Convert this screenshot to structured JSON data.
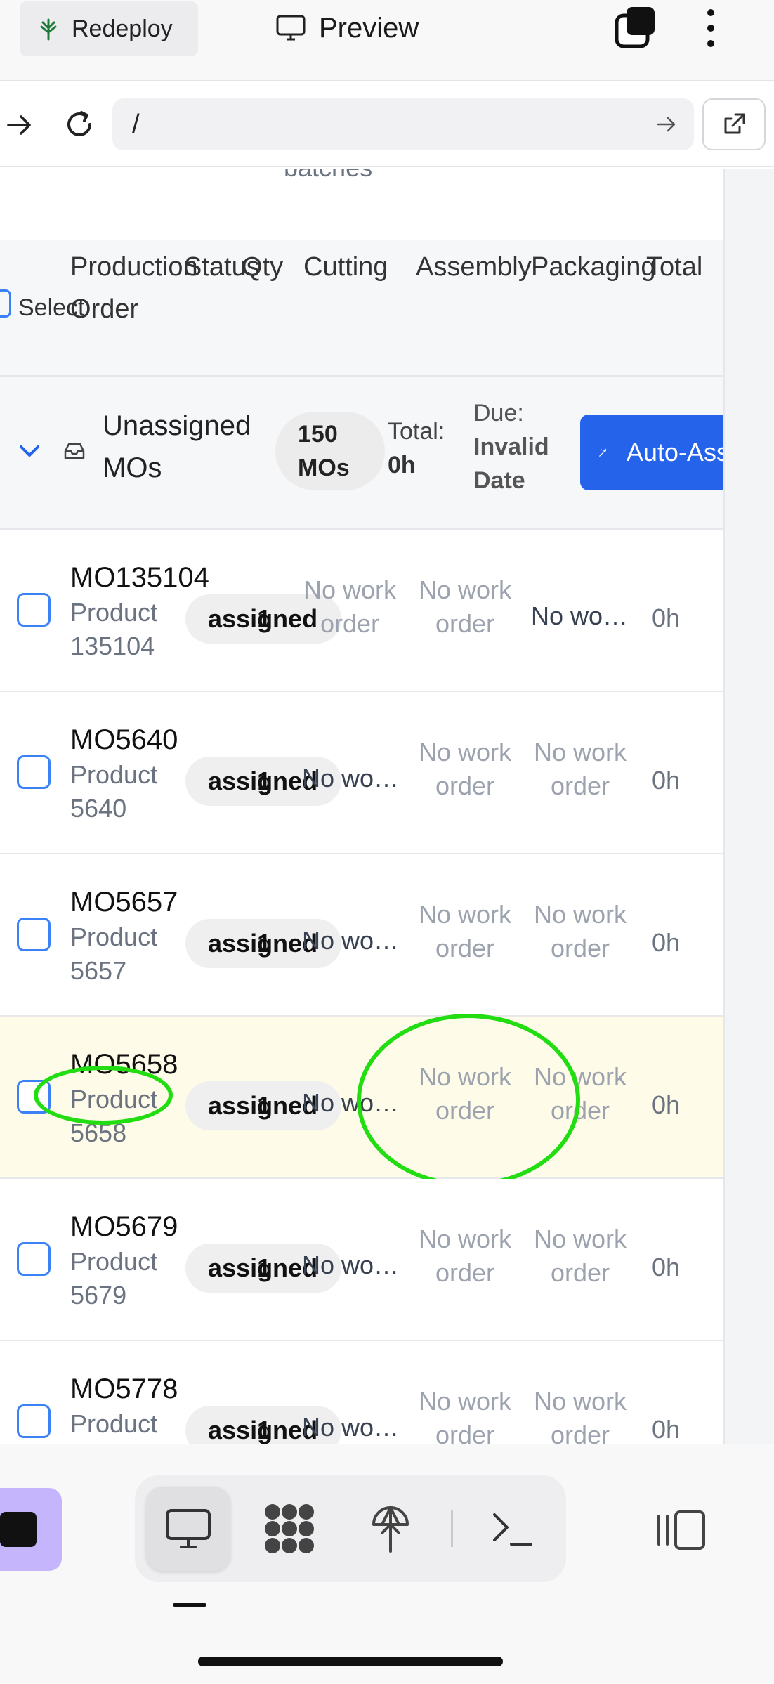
{
  "toolbar": {
    "redeploy_label": "Redeploy",
    "preview_label": "Preview"
  },
  "address": {
    "url": "/"
  },
  "content": {
    "partial_header_text": "batches"
  },
  "table": {
    "columns": {
      "select": "Select",
      "production_order": "Production Order",
      "status": "Status",
      "qty": "Qty",
      "cutting": "Cutting",
      "assembly": "Assembly",
      "packaging": "Packaging",
      "total": "Total"
    }
  },
  "group": {
    "title": "Unassigned MOs",
    "count_label": "150 MOs",
    "total_label": "Total:",
    "total_value": "0h",
    "due_label": "Due:",
    "due_value": "Invalid Date",
    "auto_assign_label": "Auto-Assign"
  },
  "rows": [
    {
      "mo": "MO135104",
      "product": "Product 135104",
      "status": "assigned",
      "qty": "1",
      "cutting": "No work order",
      "assembly": "No work order",
      "packaging": "No wo…",
      "total": "0h"
    },
    {
      "mo": "MO5640",
      "product": "Product 5640",
      "status": "assigned",
      "qty": "1",
      "cutting": "No wo…",
      "assembly": "No work order",
      "packaging": "No work order",
      "total": "0h"
    },
    {
      "mo": "MO5657",
      "product": "Product 5657",
      "status": "assigned",
      "qty": "1",
      "cutting": "No wo…",
      "assembly": "No work order",
      "packaging": "No work order",
      "total": "0h"
    },
    {
      "mo": "MO5658",
      "product": "Product 5658",
      "status": "assigned",
      "qty": "1",
      "cutting": "No wo…",
      "assembly": "No work order",
      "packaging": "No work order",
      "total": "0h"
    },
    {
      "mo": "MO5679",
      "product": "Product 5679",
      "status": "assigned",
      "qty": "1",
      "cutting": "No wo…",
      "assembly": "No work order",
      "packaging": "No work order",
      "total": "0h"
    },
    {
      "mo": "MO5778",
      "product": "Product",
      "status": "assigned",
      "qty": "1",
      "cutting": "No wo…",
      "assembly": "No work order",
      "packaging": "No work order",
      "total": "0h"
    }
  ],
  "colors": {
    "accent": "#2563eb",
    "highlight_row": "#fefce8",
    "annotation": "#22dd11",
    "purple_tab": "#c4b5fd"
  },
  "icons": {
    "redeploy": "tree-icon",
    "preview": "monitor-icon",
    "tabs": "tabs-stack-icon",
    "more": "more-vertical-icon",
    "forward": "arrow-right-icon",
    "reload": "reload-icon",
    "go": "arrow-right-icon",
    "external": "external-link-icon",
    "group_toggle": "chevron-down-icon",
    "inbox": "inbox-icon",
    "auto_assign": "magic-wand-icon",
    "dock_preview": "monitor-icon",
    "dock_apps": "grid-blob-icon",
    "dock_deploy": "tree-icon",
    "dock_terminal": "terminal-icon",
    "dock_layout": "panel-icon"
  }
}
